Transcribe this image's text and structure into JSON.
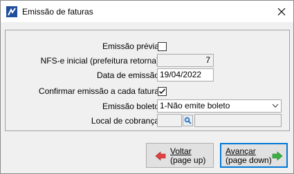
{
  "window": {
    "title": "Emissão de faturas"
  },
  "form": {
    "emissao_previa": {
      "label": "Emissão prévia",
      "checked": false
    },
    "nfse_inicial": {
      "label": "NFS-e inicial (prefeitura retorna)",
      "value": "7"
    },
    "data_emissao": {
      "label": "Data de emissão",
      "value": "19/04/2022"
    },
    "confirmar": {
      "label": "Confirmar emissão a cada fatura",
      "checked": true
    },
    "emissao_boleto": {
      "label": "Emissão boleto",
      "selected": "1-Não emite boleto"
    },
    "local_cobranca": {
      "label": "Local de cobrança",
      "code": "",
      "description": ""
    }
  },
  "buttons": {
    "voltar": {
      "line1": "Voltar",
      "line2": "(page up)",
      "color": "#e04040"
    },
    "avancar": {
      "line1": "Avançar",
      "line2": "(page down)",
      "color": "#3cb043"
    }
  },
  "colors": {
    "accent": "#0078d7"
  }
}
